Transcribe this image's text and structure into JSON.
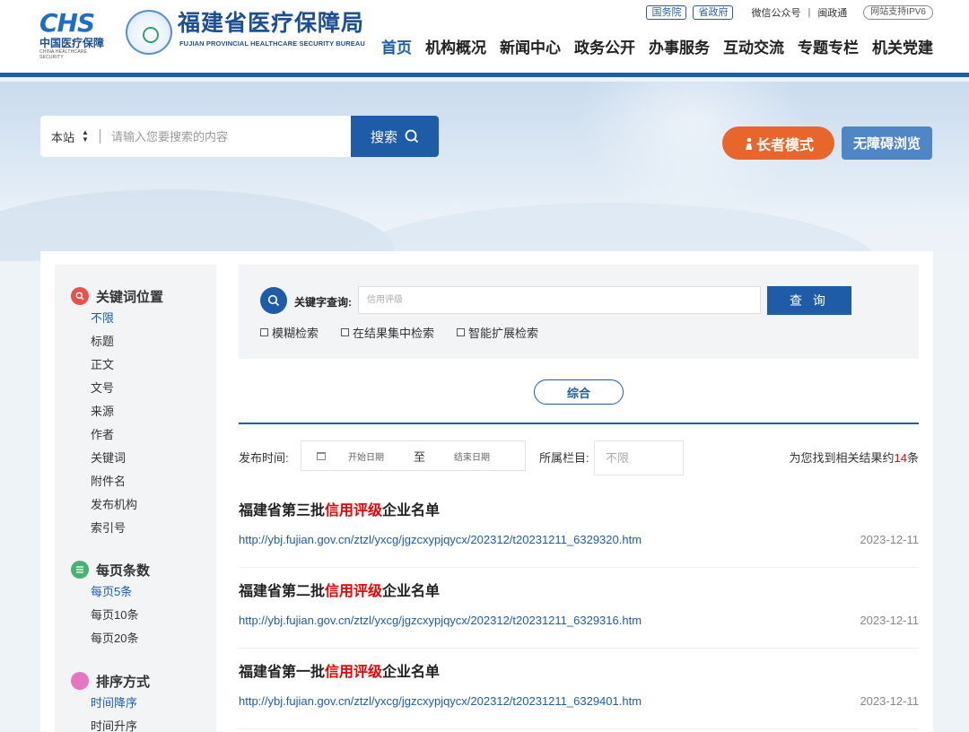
{
  "header": {
    "chs_mark": "CHS",
    "chs_cn": "中国医疗保障",
    "chs_en": "CHINA HEALTHCARE SECURITY",
    "bureau_title": "福建省医疗保障局",
    "bureau_en": "FUJIAN PROVINCIAL HEALTHCARE SECURITY BUREAU",
    "top_links": {
      "state_council": "国务院",
      "province_gov": "省政府",
      "wechat": "微信公众号",
      "separator": "|",
      "minzhengtong": "闽政通",
      "ipv6": "网站支持IPV6"
    },
    "nav": [
      "首页",
      "机构概况",
      "新闻中心",
      "政务公开",
      "办事服务",
      "互动交流",
      "专题专栏",
      "机关党建"
    ]
  },
  "search": {
    "scope": "本站",
    "placeholder": "请输入您要搜索的内容",
    "button": "搜索"
  },
  "buttons": {
    "elder_mode": "长者模式",
    "accessibility": "无障碍浏览"
  },
  "sidebar": {
    "keyword_position": {
      "title": "关键词位置",
      "options": [
        "不限",
        "标题",
        "正文",
        "文号",
        "来源",
        "作者",
        "关键词",
        "附件名",
        "发布机构",
        "索引号"
      ]
    },
    "per_page": {
      "title": "每页条数",
      "options": [
        "每页5条",
        "每页10条",
        "每页20条"
      ]
    },
    "sort": {
      "title": "排序方式",
      "options": [
        "时间降序",
        "时间升序"
      ]
    }
  },
  "query": {
    "label": "关键字查询:",
    "placeholder": "信用评级",
    "button": "查 询",
    "checks": [
      "模糊检索",
      "在结果集中检索",
      "智能扩展检索"
    ]
  },
  "tab": "综合",
  "filters": {
    "time_label": "发布时间:",
    "start_placeholder": "开始日期",
    "to": "至",
    "end_placeholder": "结束日期",
    "column_label": "所属栏目:",
    "column_value": "不限",
    "found_prefix": "为您找到相关结果约",
    "found_count": "14",
    "found_suffix": "条"
  },
  "results": [
    {
      "title_pre": "福建省第三批",
      "title_hl": "信用评级",
      "title_post": "企业名单",
      "url": "http://ybj.fujian.gov.cn/ztzl/yxcg/jgzcxypjqycx/202312/t20231211_6329320.htm",
      "date": "2023-12-11"
    },
    {
      "title_pre": "福建省第二批",
      "title_hl": "信用评级",
      "title_post": "企业名单",
      "url": "http://ybj.fujian.gov.cn/ztzl/yxcg/jgzcxypjqycx/202312/t20231211_6329316.htm",
      "date": "2023-12-11"
    },
    {
      "title_pre": "福建省第一批",
      "title_hl": "信用评级",
      "title_post": "企业名单",
      "url": "http://ybj.fujian.gov.cn/ztzl/yxcg/jgzcxypjqycx/202312/t20231211_6329401.htm",
      "date": "2023-12-11"
    }
  ]
}
